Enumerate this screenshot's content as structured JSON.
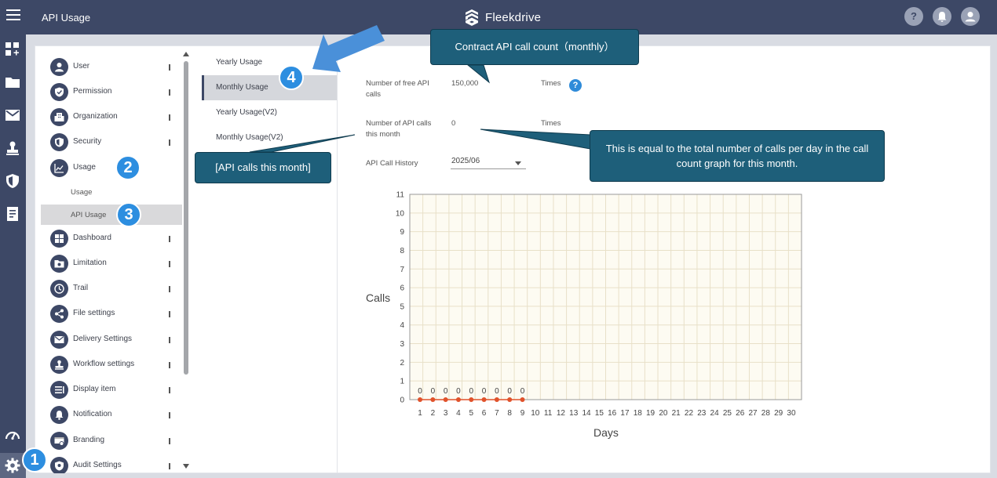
{
  "header": {
    "page_title": "API Usage",
    "brand": "Fleekdrive",
    "icons": [
      "help-icon",
      "bell-icon",
      "user-avatar-icon"
    ]
  },
  "rail": {
    "icons": [
      "dashboard-add-icon",
      "folder-icon",
      "mail-icon",
      "stamp-icon",
      "shield-icon",
      "document-icon",
      "speedometer-icon",
      "gear-icon"
    ]
  },
  "menu": {
    "items": [
      {
        "label": "User",
        "icon": "user-icon"
      },
      {
        "label": "Permission",
        "icon": "shield-check-icon"
      },
      {
        "label": "Organization",
        "icon": "building-icon"
      },
      {
        "label": "Security",
        "icon": "security-shield-icon"
      },
      {
        "label": "Usage",
        "icon": "chart-line-icon"
      },
      {
        "label": "Dashboard",
        "icon": "grid-icon"
      },
      {
        "label": "Limitation",
        "icon": "folder-limit-icon"
      },
      {
        "label": "Trail",
        "icon": "clock-icon"
      },
      {
        "label": "File settings",
        "icon": "share-icon"
      },
      {
        "label": "Delivery Settings",
        "icon": "mail-icon"
      },
      {
        "label": "Workflow settings",
        "icon": "stamp-icon"
      },
      {
        "label": "Display item",
        "icon": "list-icon"
      },
      {
        "label": "Notification",
        "icon": "bell-icon"
      },
      {
        "label": "Branding",
        "icon": "brand-icon"
      },
      {
        "label": "Audit Settings",
        "icon": "audit-icon"
      }
    ],
    "sub_items": [
      {
        "label": "Usage"
      },
      {
        "label": "API Usage"
      }
    ]
  },
  "tabs": [
    {
      "label": "Yearly Usage"
    },
    {
      "label": "Monthly Usage"
    },
    {
      "label": "Yearly Usage(V2)"
    },
    {
      "label": "Monthly Usage(V2)"
    }
  ],
  "fields": {
    "free_calls_label": "Number of free API calls",
    "free_calls_value": "150,000",
    "free_calls_unit": "Times",
    "month_calls_label": "Number of API calls this month",
    "month_calls_value": "0",
    "month_calls_unit": "Times",
    "history_label": "API Call History",
    "history_value": "2025/06"
  },
  "callouts": {
    "contract": "Contract API call count（monthly）",
    "month": "[API calls this month]",
    "equal": "This is equal to the total number of calls per day in the call count graph for this month."
  },
  "badges": [
    "1",
    "2",
    "3",
    "4"
  ],
  "colors": {
    "header_bg": "#3d4866",
    "callout_bg": "#1e5f7a",
    "badge_bg": "#2d8ee0",
    "arrow": "#4a90d9",
    "point": "#e0522b",
    "plot_bg": "#fdfbf2"
  },
  "chart_data": {
    "type": "line",
    "xlabel": "Days",
    "ylabel": "Calls",
    "ylim": [
      0,
      11
    ],
    "x": [
      1,
      2,
      3,
      4,
      5,
      6,
      7,
      8,
      9,
      10,
      11,
      12,
      13,
      14,
      15,
      16,
      17,
      18,
      19,
      20,
      21,
      22,
      23,
      24,
      25,
      26,
      27,
      28,
      29,
      30
    ],
    "yticks": [
      0,
      1,
      2,
      3,
      4,
      5,
      6,
      7,
      8,
      9,
      10,
      11
    ],
    "series": [
      {
        "x": [
          1,
          2,
          3,
          4,
          5,
          6,
          7,
          8,
          9
        ],
        "values": [
          0,
          0,
          0,
          0,
          0,
          0,
          0,
          0,
          0
        ]
      }
    ],
    "grid": true
  }
}
